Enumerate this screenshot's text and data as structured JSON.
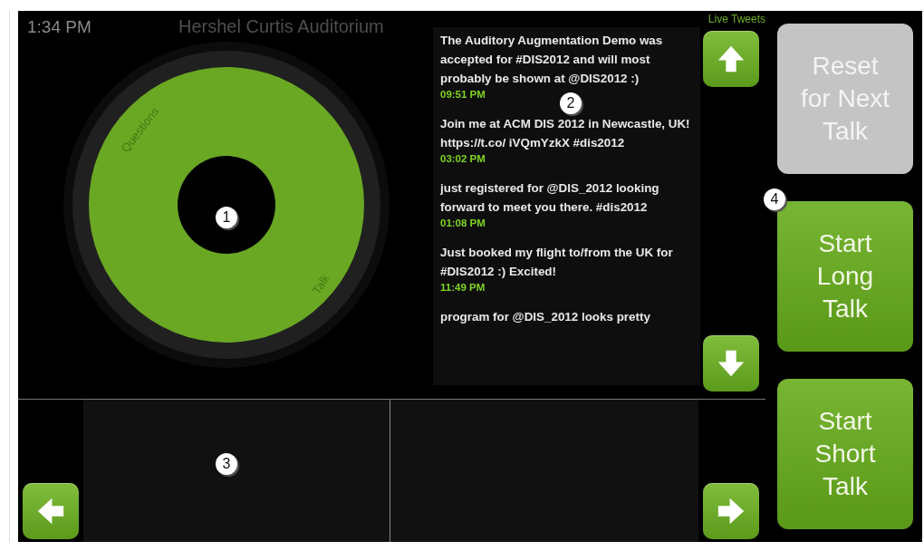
{
  "status": {
    "time": "1:34 PM",
    "room": "Hershel Curtis Auditorium"
  },
  "dial": {
    "segments": [
      {
        "label": "Questions"
      },
      {
        "label": "Talk"
      }
    ]
  },
  "tweets": {
    "title": "Live Tweets",
    "items": [
      {
        "text": "The Auditory Augmentation Demo was accepted for #DIS2012 and will most probably be shown at @DIS2012 :)",
        "time": "09:51 PM"
      },
      {
        "text": "Join me at ACM DIS 2012 in Newcastle, UK! https://t.co/ iVQmYzkX #dis2012",
        "time": "03:02 PM"
      },
      {
        "text": "just registered for @DIS_2012 looking forward to meet you there. #dis2012",
        "time": "01:08 PM"
      },
      {
        "text": "Just booked my flight to/from the UK for #DIS2012 :) Excited!",
        "time": "11:49 PM"
      },
      {
        "text": "program for @DIS_2012 looks pretty"
      }
    ]
  },
  "scroll_buttons": [
    {
      "kind": "up"
    },
    {
      "kind": "down"
    }
  ],
  "nav_buttons": [
    {
      "kind": "left"
    },
    {
      "kind": "right"
    }
  ],
  "actions": [
    {
      "label": "Reset for Next Talk",
      "disabled": true
    },
    {
      "label": "Start Long Talk",
      "disabled": false
    },
    {
      "label": "Start Short Talk",
      "disabled": false
    }
  ],
  "callouts": [
    "1",
    "2",
    "3",
    "4"
  ]
}
